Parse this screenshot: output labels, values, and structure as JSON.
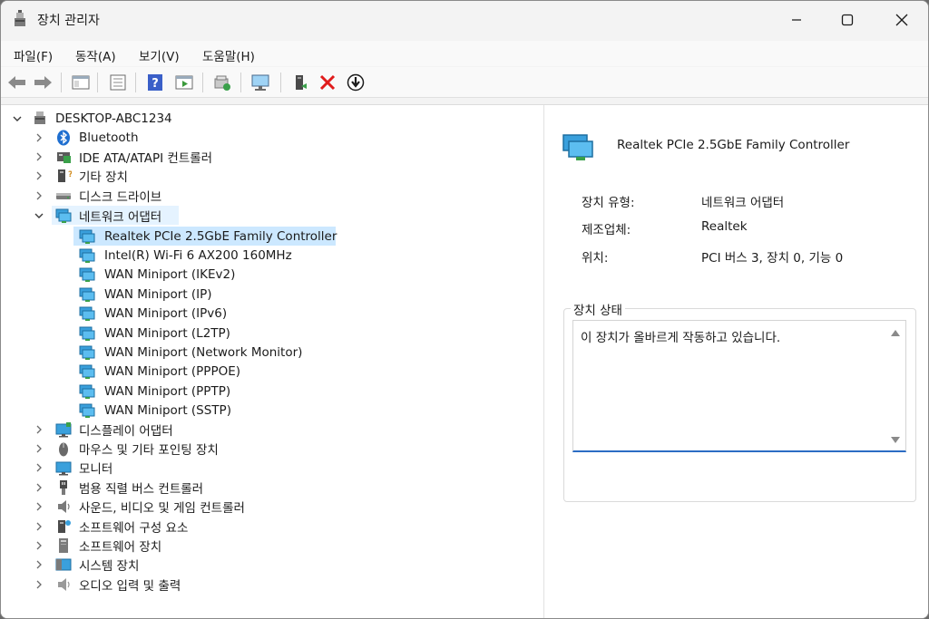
{
  "window": {
    "title": "장치 관리자",
    "minimize_icon": "minimize-icon",
    "maximize_icon": "maximize-icon",
    "close_icon": "close-icon"
  },
  "menu": {
    "items": [
      "파일(F)",
      "동작(A)",
      "보기(V)",
      "도움말(H)"
    ]
  },
  "toolbar": {
    "buttons": [
      "back-icon",
      "forward-icon",
      "show-hide-tree-icon",
      "properties-icon",
      "help-icon",
      "action-pane-icon",
      "update-driver-icon",
      "scan-hardware-icon",
      "enable-device-icon",
      "uninstall-icon",
      "download-icon"
    ]
  },
  "tree": {
    "root": "DESKTOP-ABC1234",
    "categories": [
      {
        "label": "Bluetooth",
        "icon": "bluetooth-icon"
      },
      {
        "label": "IDE ATA/ATAPI 컨트롤러",
        "icon": "ide-controller-icon"
      },
      {
        "label": "기타 장치",
        "icon": "other-device-icon"
      },
      {
        "label": "디스크 드라이브",
        "icon": "disk-drive-icon"
      },
      {
        "label": "네트워크 어댑터",
        "icon": "network-adapter-icon",
        "expanded": true
      }
    ],
    "network_adapters": [
      "Realtek PCIe 2.5GbE Family Controller",
      "Intel(R) Wi-Fi 6 AX200 160MHz",
      "WAN Miniport (IKEv2)",
      "WAN Miniport (IP)",
      "WAN Miniport (IPv6)",
      "WAN Miniport (L2TP)",
      "WAN Miniport (Network Monitor)",
      "WAN Miniport (PPPOE)",
      "WAN Miniport (PPTP)",
      "WAN Miniport (SSTP)"
    ],
    "categories_after": [
      {
        "label": "디스플레이 어댑터",
        "icon": "display-adapter-icon"
      },
      {
        "label": "마우스 및 기타 포인팅 장치",
        "icon": "mouse-icon"
      },
      {
        "label": "모니터",
        "icon": "monitor-icon"
      },
      {
        "label": "범용 직렬 버스 컨트롤러",
        "icon": "usb-icon"
      },
      {
        "label": "사운드, 비디오 및 게임 컨트롤러",
        "icon": "speaker-icon"
      },
      {
        "label": "소프트웨어 구성 요소",
        "icon": "software-component-icon"
      },
      {
        "label": "소프트웨어 장치",
        "icon": "software-device-icon"
      },
      {
        "label": "시스템 장치",
        "icon": "system-device-icon"
      },
      {
        "label": "오디오 입력 및 출력",
        "icon": "audio-io-icon"
      }
    ]
  },
  "details": {
    "device_name": "Realtek PCIe 2.5GbE Family Controller",
    "props": [
      {
        "label": "장치 유형:",
        "value": "네트워크 어댑터"
      },
      {
        "label": "제조업체:",
        "value": "Realtek"
      },
      {
        "label": "위치:",
        "value": "PCI 버스 3, 장치 0, 기능 0"
      }
    ],
    "status_group_title": "장치 상태",
    "status_text": "이 장치가 올바르게 작동하고 있습니다."
  },
  "colors": {
    "selection": "#cce8ff",
    "accent": "#2b6cc4",
    "network_icon": "#3aa0dc"
  }
}
